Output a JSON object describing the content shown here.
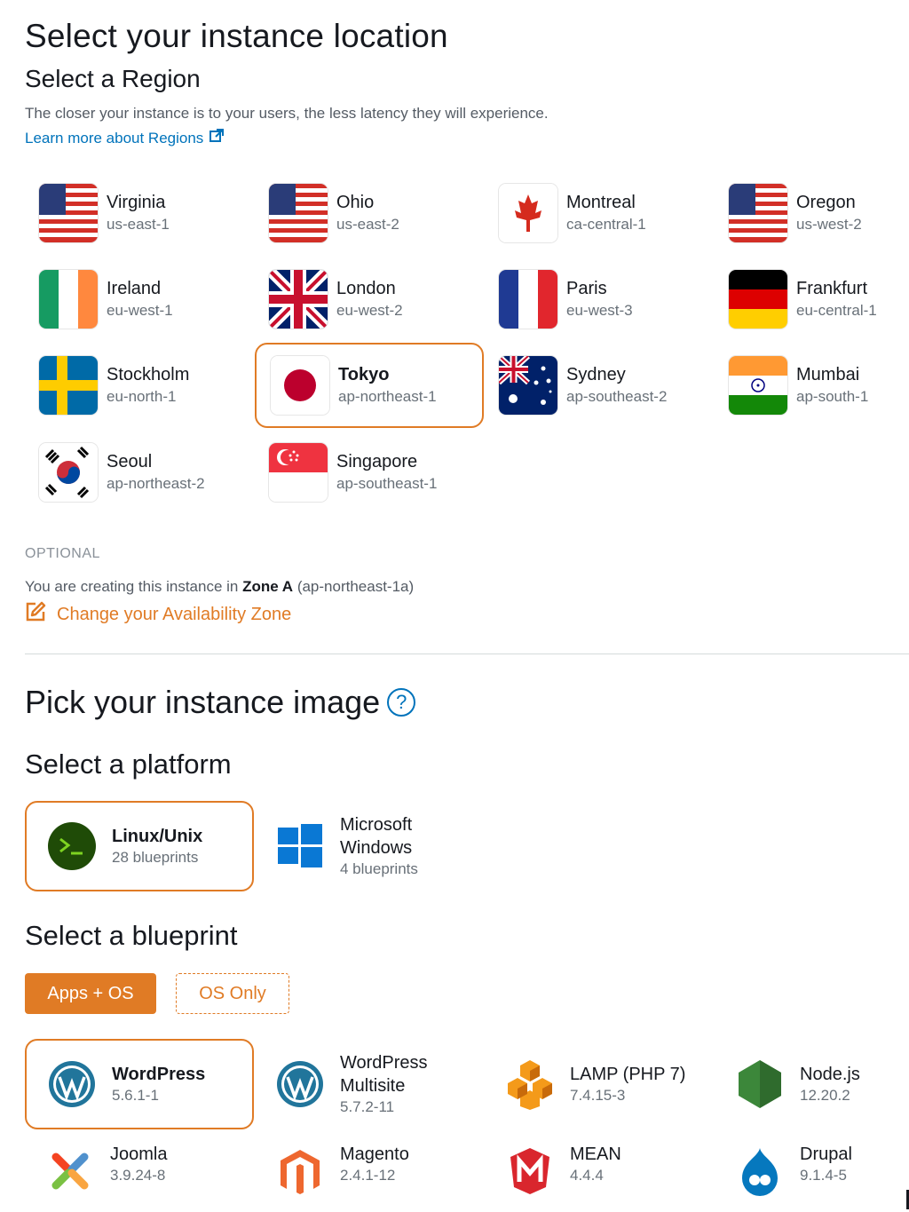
{
  "header": {
    "title": "Select your instance location",
    "region_heading": "Select a Region",
    "region_description": "The closer your instance is to your users, the less latency they will experience.",
    "learn_more": "Learn more about Regions",
    "learn_more_icon": "external-link-icon"
  },
  "regions": [
    {
      "name": "Virginia",
      "code": "us-east-1",
      "flag": "us",
      "selected": false
    },
    {
      "name": "Ohio",
      "code": "us-east-2",
      "flag": "us",
      "selected": false
    },
    {
      "name": "Montreal",
      "code": "ca-central-1",
      "flag": "ca",
      "selected": false
    },
    {
      "name": "Oregon",
      "code": "us-west-2",
      "flag": "us",
      "selected": false
    },
    {
      "name": "Ireland",
      "code": "eu-west-1",
      "flag": "ie",
      "selected": false
    },
    {
      "name": "London",
      "code": "eu-west-2",
      "flag": "gb",
      "selected": false
    },
    {
      "name": "Paris",
      "code": "eu-west-3",
      "flag": "fr",
      "selected": false
    },
    {
      "name": "Frankfurt",
      "code": "eu-central-1",
      "flag": "de",
      "selected": false
    },
    {
      "name": "Stockholm",
      "code": "eu-north-1",
      "flag": "se",
      "selected": false
    },
    {
      "name": "Tokyo",
      "code": "ap-northeast-1",
      "flag": "jp",
      "selected": true
    },
    {
      "name": "Sydney",
      "code": "ap-southeast-2",
      "flag": "au",
      "selected": false
    },
    {
      "name": "Mumbai",
      "code": "ap-south-1",
      "flag": "in",
      "selected": false
    },
    {
      "name": "Seoul",
      "code": "ap-northeast-2",
      "flag": "kr",
      "selected": false
    },
    {
      "name": "Singapore",
      "code": "ap-southeast-1",
      "flag": "sg",
      "selected": false
    }
  ],
  "availability_zone": {
    "optional_label": "OPTIONAL",
    "prefix": "You are creating this instance in",
    "zone": "Zone A",
    "zone_code": "(ap-northeast-1a)",
    "change_label": "Change your Availability Zone",
    "change_icon": "edit-icon"
  },
  "image_section": {
    "title": "Pick your instance image",
    "help_icon": "help-icon",
    "help_glyph": "?",
    "platform_heading": "Select a platform",
    "platforms": [
      {
        "name": "Linux/Unix",
        "sub": "28 blueprints",
        "icon": "terminal-icon",
        "selected": true
      },
      {
        "name_line1": "Microsoft",
        "name_line2": "Windows",
        "sub": "4 blueprints",
        "icon": "windows-icon",
        "selected": false
      }
    ],
    "blueprint_heading": "Select a blueprint",
    "blueprint_tabs": {
      "apps_os": "Apps + OS",
      "os_only": "OS Only"
    },
    "blueprints": [
      {
        "name": "WordPress",
        "version": "5.6.1-1",
        "icon": "wordpress-icon",
        "selected": true
      },
      {
        "name_line1": "WordPress",
        "name_line2": "Multisite",
        "version": "5.7.2-11",
        "icon": "wordpress-icon",
        "selected": false
      },
      {
        "name": "LAMP (PHP 7)",
        "version": "7.4.15-3",
        "icon": "lamp-icon",
        "selected": false
      },
      {
        "name": "Node.js",
        "version": "12.20.2",
        "icon": "nodejs-icon",
        "selected": false
      },
      {
        "name": "Joomla",
        "version": "3.9.24-8",
        "icon": "joomla-icon",
        "selected": false
      },
      {
        "name": "Magento",
        "version": "2.4.1-12",
        "icon": "magento-icon",
        "selected": false
      },
      {
        "name": "MEAN",
        "version": "4.4.4",
        "icon": "mean-icon",
        "selected": false
      },
      {
        "name": "Drupal",
        "version": "9.1.4-5",
        "icon": "drupal-icon",
        "selected": false
      }
    ]
  },
  "colors": {
    "accent": "#e07b25",
    "link": "#0073bb",
    "text": "#16191f",
    "muted": "#687078"
  }
}
